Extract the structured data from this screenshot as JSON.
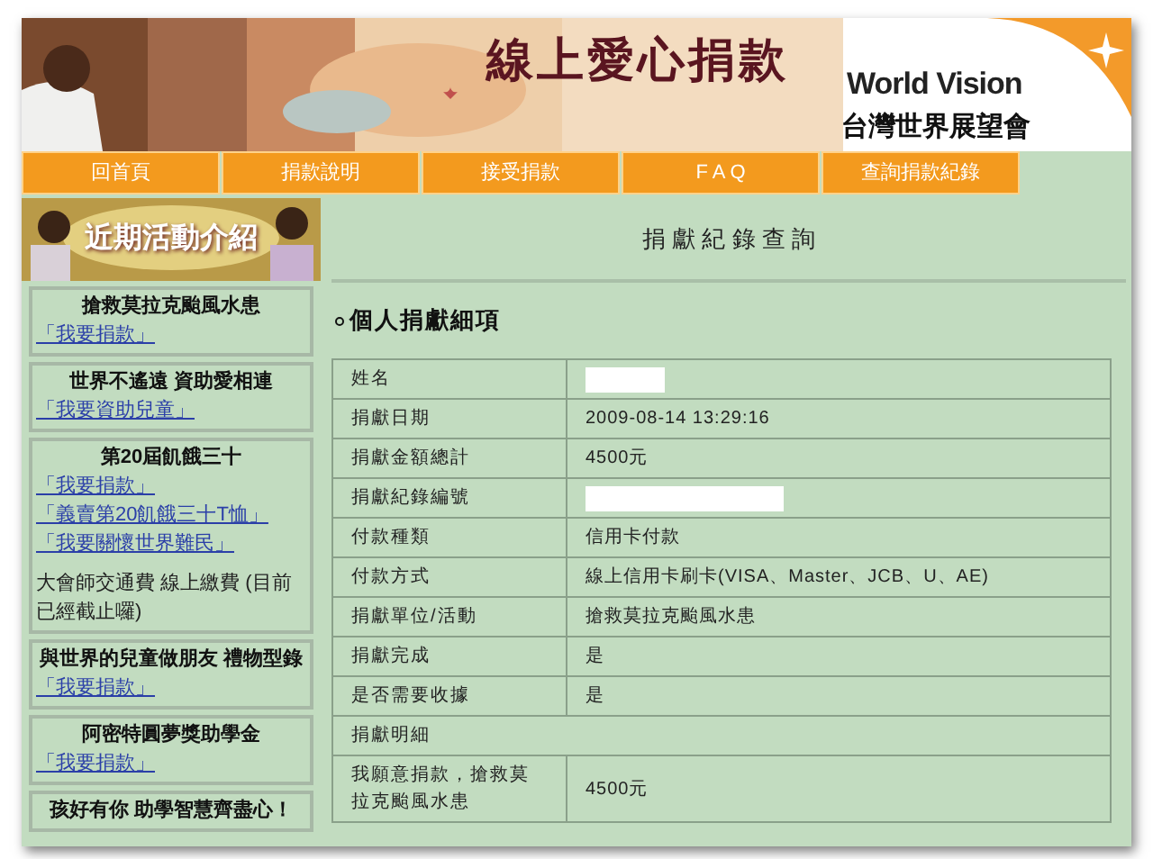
{
  "header": {
    "title": "線上愛心捐款",
    "logo_text": "World Vision",
    "logo_subtitle": "台灣世界展望會"
  },
  "nav": [
    {
      "label": "回首頁"
    },
    {
      "label": "捐款說明"
    },
    {
      "label": "接受捐款"
    },
    {
      "label": "F A Q"
    },
    {
      "label": "查詢捐款紀錄"
    }
  ],
  "sidebar": {
    "banner": "近期活動介紹",
    "sections": [
      {
        "title": "搶救莫拉克颱風水患",
        "links": [
          "「我要捐款」"
        ]
      },
      {
        "title": "世界不遙遠 資助愛相連",
        "links": [
          "「我要資助兒童」"
        ]
      },
      {
        "title": "第20屆飢餓三十",
        "links": [
          "「我要捐款」",
          "「義賣第20飢餓三十T恤」",
          "「我要關懷世界難民」"
        ],
        "note": "大會師交通費 線上繳費 (目前已經截止囉)"
      },
      {
        "title": "與世界的兒童做朋友 禮物型錄",
        "links": [
          "「我要捐款」"
        ]
      },
      {
        "title": "阿密特圓夢獎助學金",
        "links": [
          "「我要捐款」"
        ]
      },
      {
        "title": "孩好有你 助學智慧齊盡心！"
      }
    ]
  },
  "main": {
    "heading": "捐 獻 紀 錄 查 詢",
    "section_title": "個人捐獻細項",
    "rows": [
      {
        "label": "姓名",
        "redacted": true
      },
      {
        "label": "捐獻日期",
        "value": "2009-08-14 13:29:16"
      },
      {
        "label": "捐獻金額總計",
        "value": "4500元"
      },
      {
        "label": "捐獻紀錄編號",
        "redacted": true
      },
      {
        "label": "付款種類",
        "value": "信用卡付款"
      },
      {
        "label": "付款方式",
        "value": "線上信用卡刷卡(VISA、Master、JCB、U、AE)"
      },
      {
        "label": "捐獻單位/活動",
        "value": "搶救莫拉克颱風水患"
      },
      {
        "label": "捐獻完成",
        "value": "是"
      },
      {
        "label": "是否需要收據",
        "value": "是"
      },
      {
        "label": "捐獻明細",
        "kind": "span"
      },
      {
        "label": "我願意捐款，搶救莫拉克颱風水患",
        "value": "4500元"
      }
    ]
  }
}
